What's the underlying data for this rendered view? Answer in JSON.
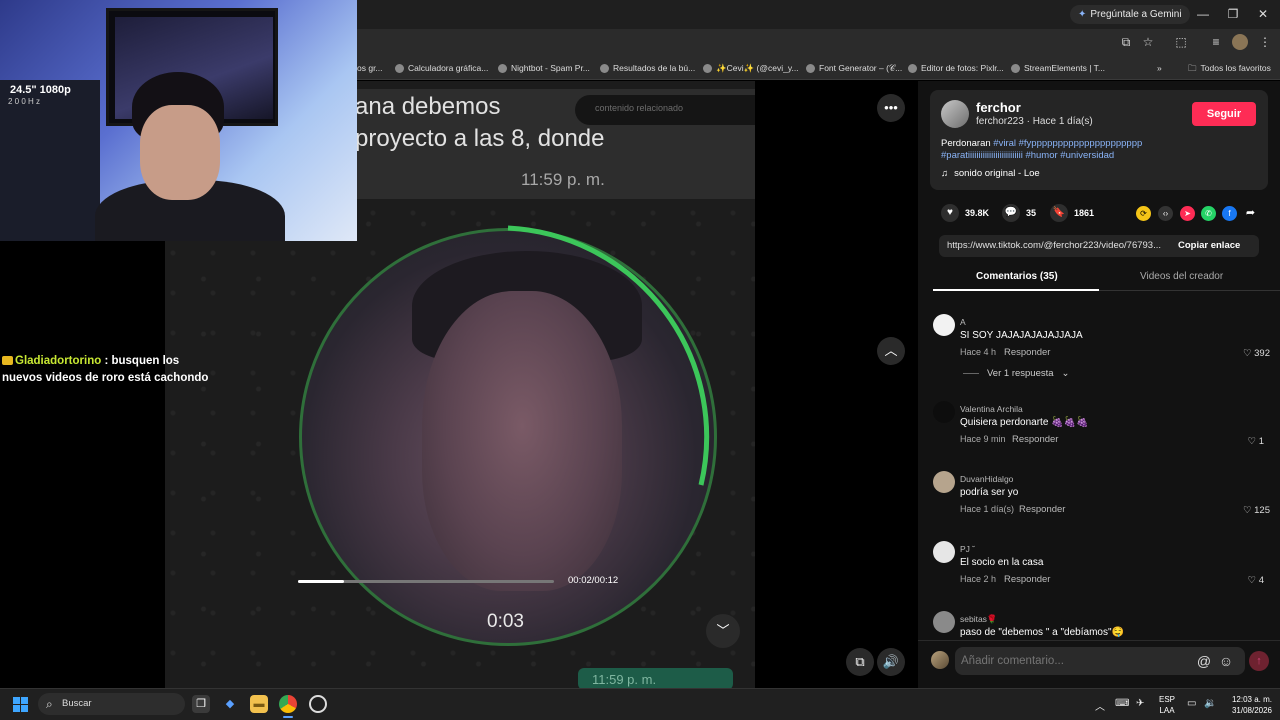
{
  "browser": {
    "gemini_label": "Pregúntale a Gemini",
    "bookmarks": [
      {
        "label": "os gr..."
      },
      {
        "label": "Calculadora gráfica..."
      },
      {
        "label": "Nightbot - Spam Pr..."
      },
      {
        "label": "Resultados de la bú..."
      },
      {
        "label": "✨Cevi✨ (@cevi_y..."
      },
      {
        "label": "Font Generator – (𝒞..."
      },
      {
        "label": "Editor de fotos: Pixlr..."
      },
      {
        "label": "StreamElements | T..."
      }
    ],
    "all_favorites": "Todos los favoritos"
  },
  "video": {
    "bubble_line1": "ana debemos",
    "bubble_line2": "proyecto a las 8, donde",
    "bubble_time": "11:59 p. m.",
    "search_overlay": "contenido relacionado",
    "circle_timer": "0:03",
    "timecode": "00:02/00:12",
    "progress_fraction": 0.18,
    "bottom_bubble": "11:59 p. m."
  },
  "webcam": {
    "label1": "24.5\" 1080p",
    "label2": "2 0 0 H z"
  },
  "chat": {
    "user": "Gladiadortorino",
    "message": ": busquen los nuevos videos de roro está cachondo"
  },
  "author": {
    "name": "ferchor",
    "handle_meta": "ferchor223 · Hace 1 día(s)",
    "follow": "Seguir",
    "caption_prefix": "Perdonaran ",
    "caption_tags": "#viral #fyppppppppppppppppppppp #paratiiiiiiiiiiiiiiiiiiiiiiiiii #humor #universidad",
    "music": "sonido original - Loe"
  },
  "stats": {
    "likes": "39.8K",
    "comments": "35",
    "saves": "1861"
  },
  "link": {
    "url": "https://www.tiktok.com/@ferchor223/video/76793...",
    "copy": "Copiar enlace"
  },
  "tabs": {
    "comments": "Comentarios (35)",
    "videos": "Videos del creador"
  },
  "comments": [
    {
      "user": "A",
      "text": "SI SOY JAJAJAJAJAJJAJA",
      "time": "Hace 4 h",
      "reply": "Responder",
      "likes": "392"
    },
    {
      "user": "Valentina Archila",
      "text": "Quisiera perdonarte 🍇🍇🍇",
      "time": "Hace 9 min",
      "reply": "Responder",
      "likes": "1"
    },
    {
      "user": "DuvanHidalgo",
      "text": "podría ser yo",
      "time": "Hace 1 día(s)",
      "reply": "Responder",
      "likes": "125"
    },
    {
      "user": "PJ ˘",
      "text": "El socio en la casa",
      "time": "Hace 2 h",
      "reply": "Responder",
      "likes": "4"
    },
    {
      "user": "sebitas🌹",
      "text": "paso de \"debemos \" a \"debíamos\"🤤",
      "time": "",
      "reply": "",
      "likes": ""
    }
  ],
  "view_replies": "Ver 1 respuesta",
  "comment_input": {
    "placeholder": "Añadir comentario..."
  },
  "taskbar": {
    "search": "Buscar",
    "lang1": "ESP",
    "lang2": "LAA",
    "time": "12:03 a. m.",
    "date": "31/08/2026"
  },
  "colors": {
    "follow": "#fe2c55",
    "tag": "#8ab4f8",
    "chat_user": "#c8e833",
    "ring": "#2f6f3a"
  }
}
